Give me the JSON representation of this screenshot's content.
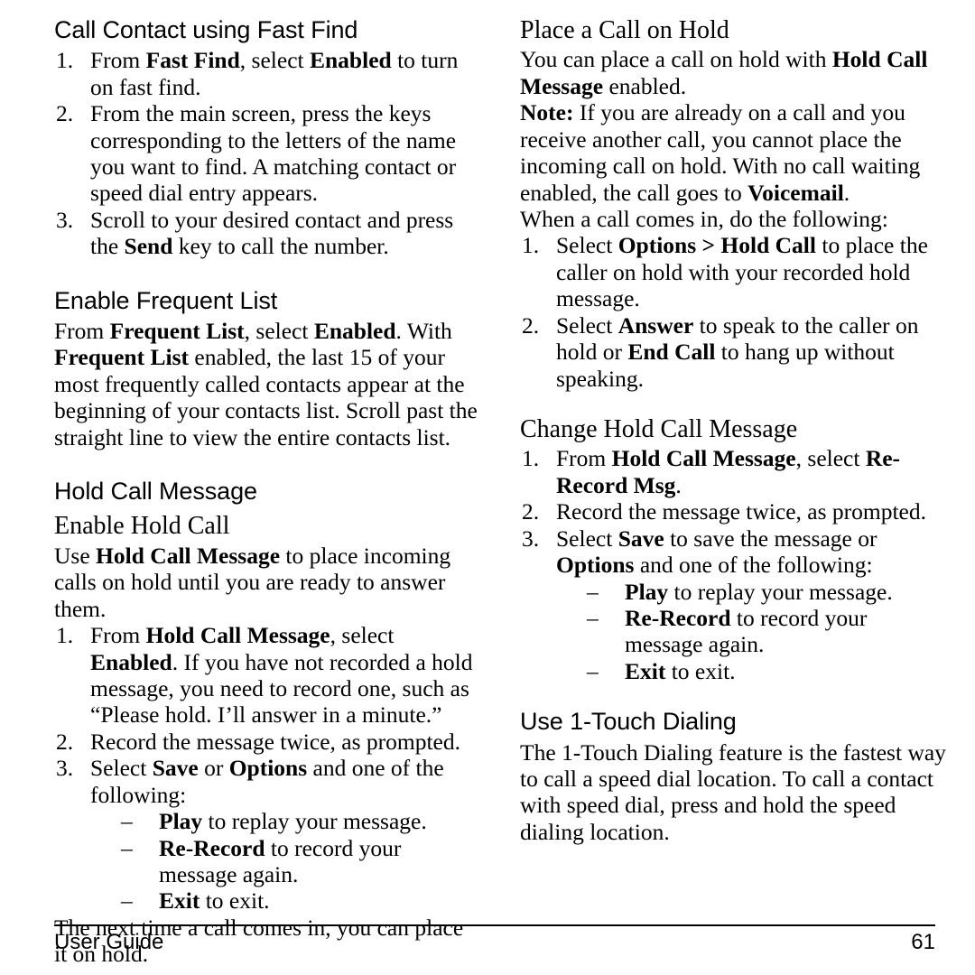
{
  "document": {
    "type": "user-guide-page",
    "page_number": "61",
    "footer_left": "User Guide"
  },
  "left_column": {
    "sections": [
      {
        "heading": "Call Contact using Fast Find",
        "heading_style": "sans",
        "steps": [
          {
            "num": "1.",
            "html": "From <b>Fast Find</b>, select <b>Enabled</b> to turn on fast find."
          },
          {
            "num": "2.",
            "html": "From the main screen, press the keys corresponding to the letters of the name you want to find. A matching contact or speed dial entry appears."
          },
          {
            "num": "3.",
            "html": "Scroll to your desired contact and press the <b>Send</b> key to call the number."
          }
        ]
      },
      {
        "heading": "Enable Frequent List",
        "heading_style": "sans",
        "paragraphs": [
          "From <b>Frequent List</b>, select <b>Enabled</b>. With <b>Frequent List</b> enabled, the last 15 of your most frequently called contacts appear at the beginning of your contacts list. Scroll past the straight line to view the entire contacts list."
        ]
      },
      {
        "heading": "Hold Call Message",
        "heading_style": "sans"
      },
      {
        "heading": "Enable Hold Call",
        "heading_style": "serif",
        "paragraphs": [
          "Use <b>Hold Call Message</b> to place incoming calls on hold until you are ready to answer them."
        ],
        "steps": [
          {
            "num": "1.",
            "html": "From <b>Hold Call Message</b>, select <b>Enabled</b>. If you have not recorded a hold message, you need to record one, such as “Please hold. I’ll answer in a minute.”"
          },
          {
            "num": "2.",
            "html": "Record the message twice, as prompted."
          },
          {
            "num": "3.",
            "html": "Select <b>Save</b> or <b>Options</b> and one of the following:",
            "dashes": [
              "<b>Play</b> to replay your message.",
              "<b>Re-Record</b> to record your message again.",
              "<b>Exit</b> to exit."
            ]
          }
        ],
        "after_paragraphs": [
          "The next time a call comes in, you can place it on hold."
        ]
      }
    ]
  },
  "right_column": {
    "sections": [
      {
        "heading": "Place a Call on Hold",
        "heading_style": "serif",
        "paragraphs": [
          "You can place a call on hold with <b>Hold Call Message</b> enabled.",
          "<b>Note:</b> If you are already on a call and you receive another call, you cannot place the incoming call on hold. With no call waiting enabled, the call goes to <b>Voicemail</b>.",
          "When a call comes in, do the following:"
        ],
        "steps": [
          {
            "num": "1.",
            "html": "Select <b>Options &gt; Hold Call</b> to place the caller on hold with your recorded hold message."
          },
          {
            "num": "2.",
            "html": "Select <b>Answer</b> to speak to the caller on hold or <b>End Call</b> to hang up without speaking."
          }
        ]
      },
      {
        "heading": "Change Hold Call Message",
        "heading_style": "serif",
        "steps": [
          {
            "num": "1.",
            "html": "From <b>Hold Call Message</b>, select <b>Re-Record Msg</b>."
          },
          {
            "num": "2.",
            "html": "Record the message twice, as prompted."
          },
          {
            "num": "3.",
            "html": "Select <b>Save</b> to save the message or <b>Options</b> and one of the following:",
            "dashes": [
              "<b>Play</b> to replay your message.",
              "<b>Re-Record</b> to record your message again.",
              "<b>Exit</b> to exit."
            ]
          }
        ]
      },
      {
        "heading": "Use 1-Touch Dialing",
        "heading_style": "sans",
        "paragraphs": [
          "The 1-Touch Dialing feature is the fastest way to call a speed dial location. To call a contact with speed dial, press and hold the speed dialing location."
        ]
      }
    ]
  }
}
